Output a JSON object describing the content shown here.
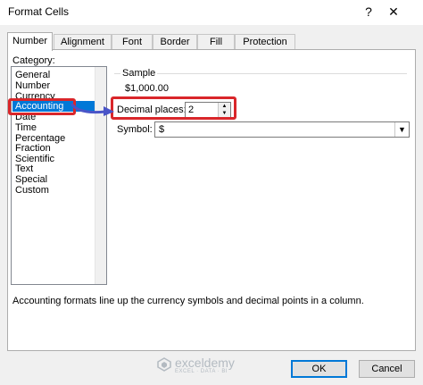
{
  "dialog": {
    "title": "Format Cells",
    "help_icon": "question-mark",
    "close_icon": "x-close"
  },
  "tabs": [
    {
      "label": "Number",
      "active": true
    },
    {
      "label": "Alignment"
    },
    {
      "label": "Font"
    },
    {
      "label": "Border"
    },
    {
      "label": "Fill"
    },
    {
      "label": "Protection"
    }
  ],
  "category": {
    "label": "Category:",
    "items": [
      "General",
      "Number",
      "Currency",
      "Accounting",
      "Date",
      "Time",
      "Percentage",
      "Fraction",
      "Scientific",
      "Text",
      "Special",
      "Custom"
    ],
    "selected": "Accounting"
  },
  "sample": {
    "label": "Sample",
    "value": "$1,000.00"
  },
  "decimal_places": {
    "label": "Decimal places:",
    "value": "2"
  },
  "symbol": {
    "label": "Symbol:",
    "value": "$"
  },
  "description": "Accounting formats line up the currency symbols and decimal points in a column.",
  "watermark": {
    "name": "exceldemy",
    "tagline": "EXCEL · DATA · BI"
  },
  "buttons": {
    "ok": "OK",
    "cancel": "Cancel"
  },
  "colors": {
    "selection": "#0078d7",
    "highlight": "#d9262a",
    "arrow": "#4a55c8",
    "default_button_border": "#0078d7"
  }
}
